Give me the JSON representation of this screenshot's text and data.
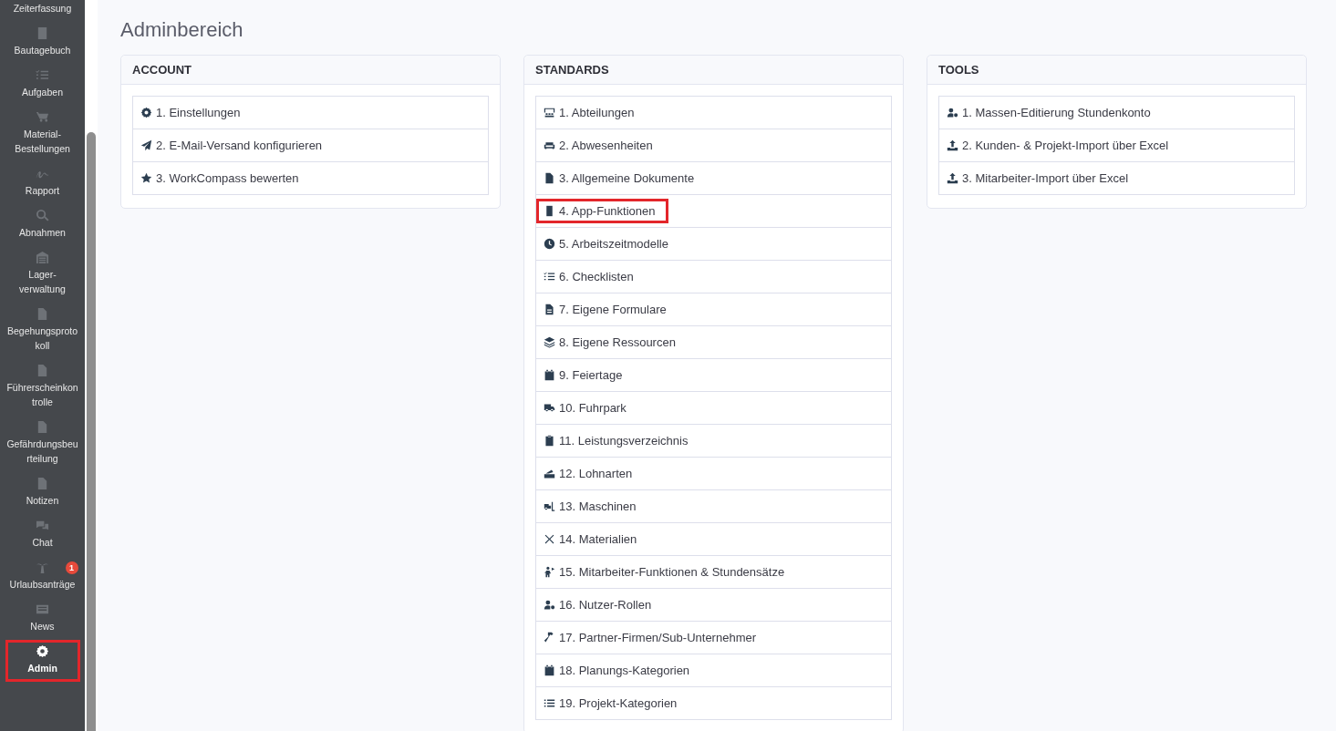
{
  "sidebar": {
    "items": [
      {
        "label": "Zeiterfassung",
        "selected": false,
        "highlighted": false
      },
      {
        "label": "Bautagebuch",
        "selected": false,
        "highlighted": false
      },
      {
        "label": "Aufgaben",
        "selected": false,
        "highlighted": false
      },
      {
        "label": "Material-Bestellungen",
        "selected": false,
        "highlighted": false
      },
      {
        "label": "Rapport",
        "selected": false,
        "highlighted": false
      },
      {
        "label": "Abnahmen",
        "selected": false,
        "highlighted": false
      },
      {
        "label": "Lager-verwaltung",
        "selected": false,
        "highlighted": false
      },
      {
        "label": "Begehungsprotokoll",
        "selected": false,
        "highlighted": false
      },
      {
        "label": "Führerscheinkontrolle",
        "selected": false,
        "highlighted": false
      },
      {
        "label": "Gefährdungsbeurteilung",
        "selected": false,
        "highlighted": false
      },
      {
        "label": "Notizen",
        "selected": false,
        "highlighted": false
      },
      {
        "label": "Chat",
        "selected": false,
        "highlighted": false
      },
      {
        "label": "Urlaubsanträge",
        "selected": false,
        "highlighted": false,
        "badge": "1"
      },
      {
        "label": "News",
        "selected": false,
        "highlighted": false
      },
      {
        "label": "Admin",
        "selected": true,
        "highlighted": true
      }
    ]
  },
  "page_title": "Adminbereich",
  "cards": [
    {
      "title": "ACCOUNT",
      "items": [
        {
          "label": "1. Einstellungen",
          "highlighted": false
        },
        {
          "label": "2. E-Mail-Versand konfigurieren",
          "highlighted": false
        },
        {
          "label": "3. WorkCompass bewerten",
          "highlighted": false
        }
      ]
    },
    {
      "title": "STANDARDS",
      "items": [
        {
          "label": "1. Abteilungen",
          "highlighted": false
        },
        {
          "label": "2. Abwesenheiten",
          "highlighted": false
        },
        {
          "label": "3. Allgemeine Dokumente",
          "highlighted": false
        },
        {
          "label": "4. App-Funktionen",
          "highlighted": true
        },
        {
          "label": "5. Arbeitszeitmodelle",
          "highlighted": false
        },
        {
          "label": "6. Checklisten",
          "highlighted": false
        },
        {
          "label": "7. Eigene Formulare",
          "highlighted": false
        },
        {
          "label": "8. Eigene Ressourcen",
          "highlighted": false
        },
        {
          "label": "9. Feiertage",
          "highlighted": false
        },
        {
          "label": "10. Fuhrpark",
          "highlighted": false
        },
        {
          "label": "11. Leistungsverzeichnis",
          "highlighted": false
        },
        {
          "label": "12. Lohnarten",
          "highlighted": false
        },
        {
          "label": "13. Maschinen",
          "highlighted": false
        },
        {
          "label": "14. Materialien",
          "highlighted": false
        },
        {
          "label": "15. Mitarbeiter-Funktionen & Stundensätze",
          "highlighted": false
        },
        {
          "label": "16. Nutzer-Rollen",
          "highlighted": false
        },
        {
          "label": "17. Partner-Firmen/Sub-Unternehmer",
          "highlighted": false
        },
        {
          "label": "18. Planungs-Kategorien",
          "highlighted": false
        },
        {
          "label": "19. Projekt-Kategorien",
          "highlighted": false
        }
      ]
    },
    {
      "title": "TOOLS",
      "items": [
        {
          "label": "1. Massen-Editierung Stundenkonto",
          "highlighted": false
        },
        {
          "label": "2. Kunden- & Projekt-Import über Excel",
          "highlighted": false
        },
        {
          "label": "3. Mitarbeiter-Import über Excel",
          "highlighted": false
        }
      ]
    }
  ]
}
